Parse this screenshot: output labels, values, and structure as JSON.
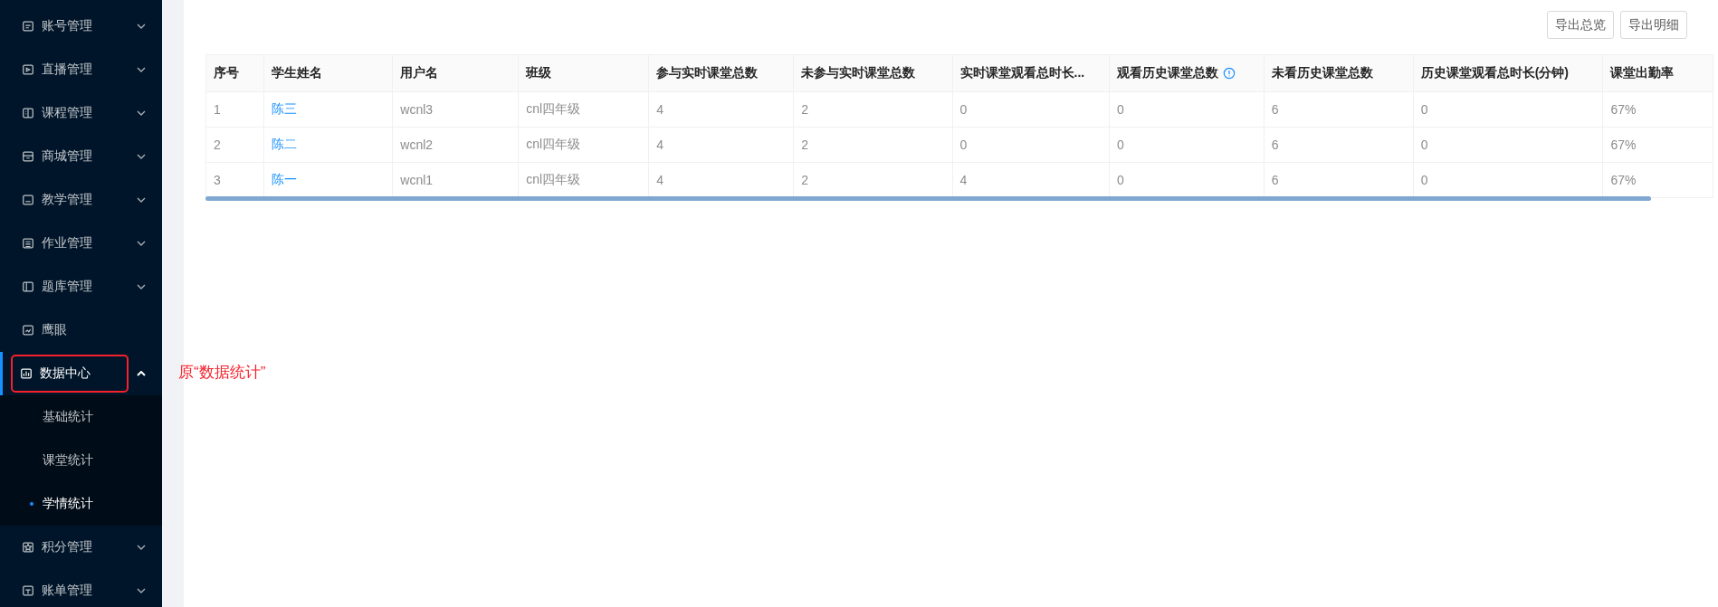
{
  "sidebar": {
    "items": [
      {
        "label": "账号管理",
        "kind": "group",
        "expanded": false,
        "active": false,
        "highlighted": false
      },
      {
        "label": "直播管理",
        "kind": "group",
        "expanded": false,
        "active": false,
        "highlighted": false
      },
      {
        "label": "课程管理",
        "kind": "group",
        "expanded": false,
        "active": false,
        "highlighted": false
      },
      {
        "label": "商城管理",
        "kind": "group",
        "expanded": false,
        "active": false,
        "highlighted": false
      },
      {
        "label": "教学管理",
        "kind": "group",
        "expanded": false,
        "active": false,
        "highlighted": false
      },
      {
        "label": "作业管理",
        "kind": "group",
        "expanded": false,
        "active": false,
        "highlighted": false
      },
      {
        "label": "题库管理",
        "kind": "group",
        "expanded": false,
        "active": false,
        "highlighted": false
      },
      {
        "label": "鹰眼",
        "kind": "link",
        "active": false,
        "highlighted": false
      },
      {
        "label": "数据中心",
        "kind": "group",
        "expanded": true,
        "active": true,
        "highlighted": true,
        "children": [
          {
            "label": "基础统计",
            "selected": false
          },
          {
            "label": "课堂统计",
            "selected": false
          },
          {
            "label": "学情统计",
            "selected": true
          }
        ]
      },
      {
        "label": "积分管理",
        "kind": "group",
        "expanded": false,
        "active": false,
        "highlighted": false
      },
      {
        "label": "账单管理",
        "kind": "group",
        "expanded": false,
        "active": false,
        "highlighted": false
      }
    ]
  },
  "annotation": {
    "text": "原“数据统计”"
  },
  "toolbar": {
    "buttons": [
      "导出总览",
      "导出明细"
    ]
  },
  "table": {
    "columns": [
      {
        "label": "序号",
        "info": false
      },
      {
        "label": "学生姓名",
        "info": false
      },
      {
        "label": "用户名",
        "info": false
      },
      {
        "label": "班级",
        "info": false
      },
      {
        "label": "参与实时课堂总数",
        "info": false
      },
      {
        "label": "未参与实时课堂总数",
        "info": false
      },
      {
        "label": "实时课堂观看总时长...",
        "info": false
      },
      {
        "label": "观看历史课堂总数",
        "info": true
      },
      {
        "label": "未看历史课堂总数",
        "info": false
      },
      {
        "label": "历史课堂观看总时长(分钟)",
        "info": false
      },
      {
        "label": "课堂出勤率",
        "info": false
      }
    ],
    "rows": [
      [
        "1",
        "陈三",
        "wcnl3",
        "cnl四年级",
        "4",
        "2",
        "0",
        "0",
        "6",
        "0",
        "67%"
      ],
      [
        "2",
        "陈二",
        "wcnl2",
        "cnl四年级",
        "4",
        "2",
        "0",
        "0",
        "6",
        "0",
        "67%"
      ],
      [
        "3",
        "陈一",
        "wcnl1",
        "cnl四年级",
        "4",
        "2",
        "4",
        "0",
        "6",
        "0",
        "67%"
      ]
    ]
  }
}
